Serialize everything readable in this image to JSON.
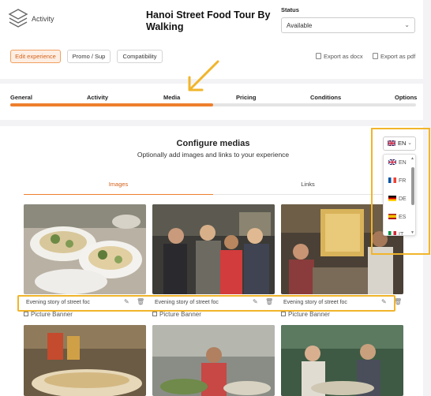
{
  "header": {
    "app_label": "Activity",
    "title": "Hanoi Street Food Tour By Walking",
    "status_label": "Status",
    "status_value": "Available"
  },
  "toolbar": {
    "buttons": [
      {
        "label": "Edit experience"
      },
      {
        "label": "Promo / Sup"
      },
      {
        "label": "Compatibility"
      }
    ],
    "export_docx": "Export as docx",
    "export_pdf": "Export as pdf"
  },
  "tabs": [
    {
      "label": "General"
    },
    {
      "label": "Activity"
    },
    {
      "label": "Media"
    },
    {
      "label": "Pricing"
    },
    {
      "label": "Conditions"
    },
    {
      "label": "Options"
    }
  ],
  "progress": {
    "percent": 50
  },
  "media": {
    "heading": "Configure medias",
    "subheading": "Optionally add images and links to your experience",
    "subtab_images": "Images",
    "subtab_links": "Links",
    "items": [
      {
        "caption": "Evening story of street foc",
        "banner": "Picture Banner"
      },
      {
        "caption": "Evening story of street foc",
        "banner": "Picture Banner"
      },
      {
        "caption": "Evening story of street foc",
        "banner": "Picture Banner"
      }
    ]
  },
  "language": {
    "selected": "EN",
    "options": [
      "EN",
      "FR",
      "DE",
      "ES",
      "IT"
    ]
  },
  "colors": {
    "accent": "#ee7f2d",
    "highlight": "#f1b52b"
  }
}
